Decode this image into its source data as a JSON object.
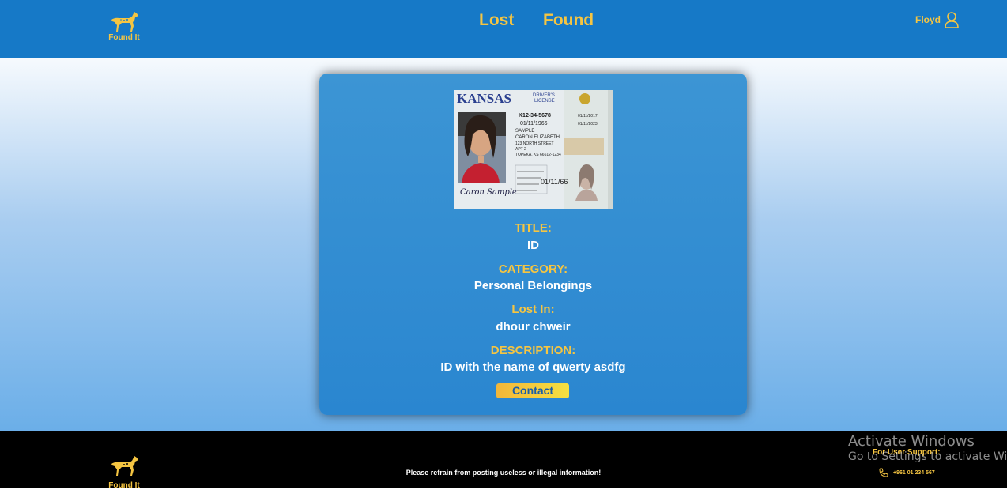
{
  "brand": {
    "name": "Found It",
    "color": "#f5c542"
  },
  "nav": {
    "lost": "Lost",
    "found": "Found"
  },
  "user": {
    "name": "Floyd",
    "icon": "user-icon"
  },
  "item": {
    "image": {
      "state": "KANSAS",
      "doc_type": "DRIVER'S LICENSE",
      "lic_no": "K12-34-5678",
      "dob": "01/11/1966",
      "last_name": "SAMPLE",
      "first_name": "CARON ELIZABETH",
      "address1": "123 NORTH STREET",
      "address2": "APT 2",
      "city": "TOPEKA, KS 66612-1234",
      "iss": "01/11/2017",
      "exp": "01/11/2023",
      "dob_short": "01/11/66",
      "signature": "Caron Sample"
    },
    "fields": [
      {
        "label": "TITLE:",
        "value": "ID"
      },
      {
        "label": "CATEGORY:",
        "value": "Personal Belongings"
      },
      {
        "label": "Lost In:",
        "value": "dhour chweir"
      },
      {
        "label": "DESCRIPTION:",
        "value": "ID with the name of qwerty asdfg"
      }
    ],
    "contact_label": "Contact"
  },
  "footer": {
    "brand": "Found It",
    "notice": "Please refrain from posting useless or illegal information!",
    "support_label": "For User Support:",
    "phone": "+961 01 234 567"
  },
  "watermark": {
    "line1": "Activate Windows",
    "line2": "Go to Settings to activate Windows."
  }
}
